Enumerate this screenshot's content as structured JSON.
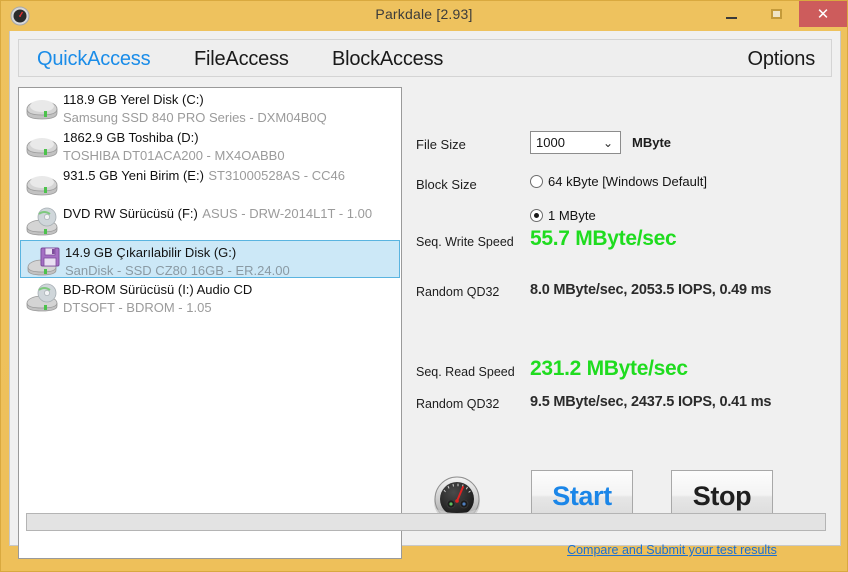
{
  "window": {
    "title": "Parkdale [2.93]",
    "app_icon": "gauge-icon",
    "minimize_label": "–",
    "maximize_label": "□",
    "close_label": "✕",
    "titlebar_color": "#eec05a",
    "close_button_color": "#cd5c5c"
  },
  "tabs": [
    {
      "label": "QuickAccess",
      "active": true,
      "color": "#1a8ce8"
    },
    {
      "label": "FileAccess",
      "active": false,
      "color": "#1a1a1a"
    },
    {
      "label": "BlockAccess",
      "active": false,
      "color": "#1a1a1a"
    },
    {
      "label": "Options",
      "active": false,
      "color": "#1a1a1a"
    }
  ],
  "drives": [
    {
      "name": "118.9 GB Yerel Disk (C:)",
      "model": "Samsung SSD 840 PRO Series - DXM04B0Q",
      "icon": "hard-disk-icon",
      "selected": false
    },
    {
      "name": "1862.9 GB Toshiba (D:)",
      "model": "TOSHIBA DT01ACA200 - MX4OABB0",
      "icon": "hard-disk-icon",
      "selected": false
    },
    {
      "name": "931.5 GB Yeni Birim (E:)",
      "model": "ST31000528AS - CC46",
      "icon": "hard-disk-icon",
      "selected": false
    },
    {
      "name": "DVD RW Sürücüsü (F:)",
      "model": "ASUS - DRW-2014L1T - 1.00",
      "icon": "optical-drive-icon",
      "selected": false
    },
    {
      "name": "14.9 GB Çıkarılabilir Disk (G:)",
      "model": "SanDisk - SSD CZ80 16GB - ER.24.00",
      "icon": "removable-disk-icon",
      "selected": true
    },
    {
      "name": "BD-ROM Sürücüsü (I:) Audio CD",
      "model": "DTSOFT - BDROM - 1.05",
      "icon": "optical-drive-icon",
      "selected": false
    }
  ],
  "settings": {
    "file_size_label": "File Size",
    "file_size_value": "1000",
    "file_size_unit": "MByte",
    "file_size_options": [
      "1000"
    ],
    "block_size_label": "Block Size",
    "block_size_options": [
      {
        "label": "64 kByte [Windows Default]",
        "checked": false
      },
      {
        "label": "1 MByte",
        "checked": true
      }
    ]
  },
  "results": {
    "seq_write_label": "Seq. Write Speed",
    "seq_write_value": "55.7 MByte/sec",
    "random_write_label": "Random QD32",
    "random_write_value": "8.0 MByte/sec, 2053.5 IOPS, 0.49 ms",
    "seq_read_label": "Seq. Read Speed",
    "seq_read_value": "231.2 MByte/sec",
    "random_read_label": "Random QD32",
    "random_read_value": "9.5 MByte/sec, 2437.5 IOPS, 0.41 ms",
    "speed_color": "#1fdc1f",
    "detail_color": "#2b2b2b"
  },
  "actions": {
    "gauge_icon": "gauge-icon",
    "start_label": "Start",
    "stop_label": "Stop",
    "submit_link_label": "Compare and Submit your test results",
    "start_color": "#1b86e8",
    "link_color": "#1a6fd4"
  },
  "progress": {
    "value": "",
    "percent": 0
  }
}
